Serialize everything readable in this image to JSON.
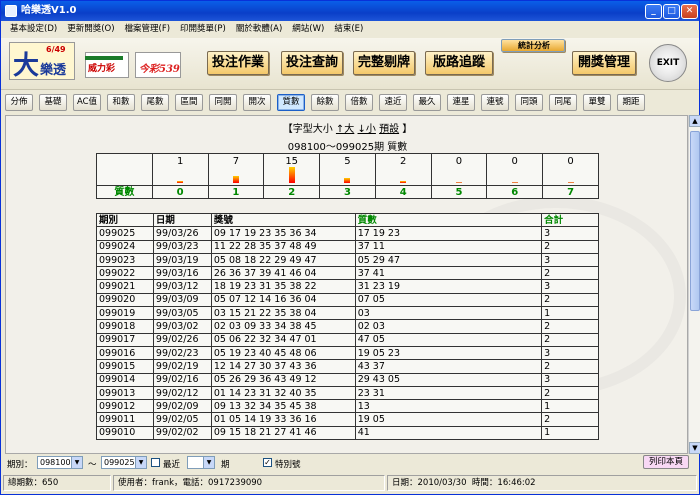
{
  "window": {
    "title": "哈樂透V1.0"
  },
  "menu": [
    "基本設定(D)",
    "更新開獎(O)",
    "檔案管理(F)",
    "印開獎單(P)",
    "關於軟體(A)",
    "網站(W)",
    "結束(E)"
  ],
  "logos": {
    "big_lotto": {
      "num": "大",
      "text": "樂透",
      "small": "6/49"
    },
    "power": "威力彩",
    "daily539": "今彩539"
  },
  "main_buttons": [
    "投注作業",
    "投注查詢",
    "完整剔牌",
    "版路追蹤",
    "統計分析",
    "開獎管理"
  ],
  "exit_label": "EXIT",
  "sub_buttons": [
    "分佈",
    "基礎",
    "AC值",
    "和數",
    "尾數",
    "區間",
    "同開",
    "開次",
    "質數",
    "餘數",
    "倍數",
    "遠近",
    "最久",
    "連星",
    "連號",
    "同頭",
    "同尾",
    "單雙",
    "期距"
  ],
  "active_sub": "質數",
  "header": {
    "bracket_open": "【字型大小",
    "inc": "↑大",
    "dec": "↓小",
    "preset": "預設",
    "bracket_close": "】",
    "range": "098100～099025期 質數"
  },
  "distribution": {
    "label": "質數",
    "columns": [
      0,
      1,
      2,
      3,
      4,
      5,
      6,
      7
    ],
    "counts": [
      1,
      7,
      15,
      5,
      2,
      0,
      0,
      0
    ]
  },
  "table": {
    "headers": [
      "期別",
      "日期",
      "獎號",
      "質數",
      "合計"
    ],
    "rows": [
      [
        "099025",
        "99/03/26",
        "09 17 19 23 35 36 34",
        "17 19 23",
        "3"
      ],
      [
        "099024",
        "99/03/23",
        "11 22 28 35 37 48 49",
        "37 11",
        "2"
      ],
      [
        "099023",
        "99/03/19",
        "05 08 18 22 29 49 47",
        "05 29 47",
        "3"
      ],
      [
        "099022",
        "99/03/16",
        "26 36 37 39 41 46 04",
        "37 41",
        "2"
      ],
      [
        "099021",
        "99/03/12",
        "18 19 23 31 35 38 22",
        "31 23 19",
        "3"
      ],
      [
        "099020",
        "99/03/09",
        "05 07 12 14 16 36 04",
        "07 05",
        "2"
      ],
      [
        "099019",
        "99/03/05",
        "03 15 21 22 35 38 04",
        "03",
        "1"
      ],
      [
        "099018",
        "99/03/02",
        "02 03 09 33 34 38 45",
        "02 03",
        "2"
      ],
      [
        "099017",
        "99/02/26",
        "05 06 22 32 34 47 01",
        "47 05",
        "2"
      ],
      [
        "099016",
        "99/02/23",
        "05 19 23 40 45 48 06",
        "19 05 23",
        "3"
      ],
      [
        "099015",
        "99/02/19",
        "12 14 27 30 37 43 36",
        "43 37",
        "2"
      ],
      [
        "099014",
        "99/02/16",
        "05 26 29 36 43 49 12",
        "29 43 05",
        "3"
      ],
      [
        "099013",
        "99/02/12",
        "01 14 23 31 32 40 35",
        "23 31",
        "2"
      ],
      [
        "099012",
        "99/02/09",
        "09 13 32 34 35 45 38",
        "13",
        "1"
      ],
      [
        "099011",
        "99/02/05",
        "01 05 14 19 33 36 16",
        "19 05",
        "2"
      ],
      [
        "099010",
        "99/02/02",
        "09 15 18 21 27 41 46",
        "41",
        "1"
      ]
    ]
  },
  "filter": {
    "period_label": "期別：",
    "from": "098100",
    "tilde": "～",
    "to": "099025",
    "recent_label": "最近",
    "recent_suffix": "期",
    "special_label": "特別號",
    "print_label": "列印本頁"
  },
  "status": {
    "total": "總期數：650",
    "user": "使用者：frank，電話：0917239090",
    "date": "日期：2010/03/30",
    "time": "時間：16:46:02"
  }
}
